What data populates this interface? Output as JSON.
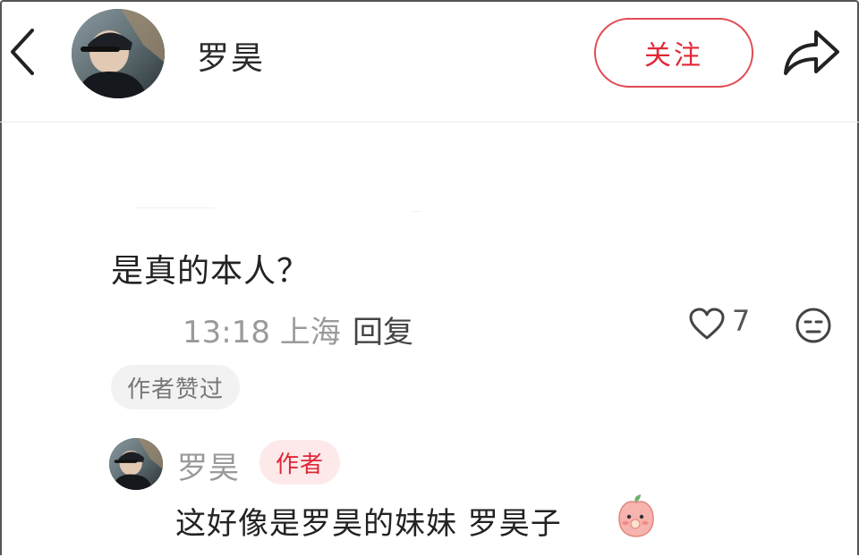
{
  "header": {
    "author_name": "罗昊",
    "follow_label": "关注"
  },
  "comment": {
    "text": "是真的本人？",
    "time_location": "13:18 上海",
    "reply_label": "回复",
    "like_count": "7",
    "liked_badge": "作者赞过"
  },
  "reply": {
    "name": "罗昊",
    "author_tag": "作者",
    "text": "这好像是罗昊的妹妹 罗昊子"
  },
  "colors": {
    "accent": "#e02836",
    "tag_bg": "#fde9ea",
    "muted_text": "#9a9a9a"
  },
  "icons": [
    "back-arrow-icon",
    "share-icon",
    "heart-icon",
    "dislike-icon",
    "peach-emoji-icon"
  ]
}
